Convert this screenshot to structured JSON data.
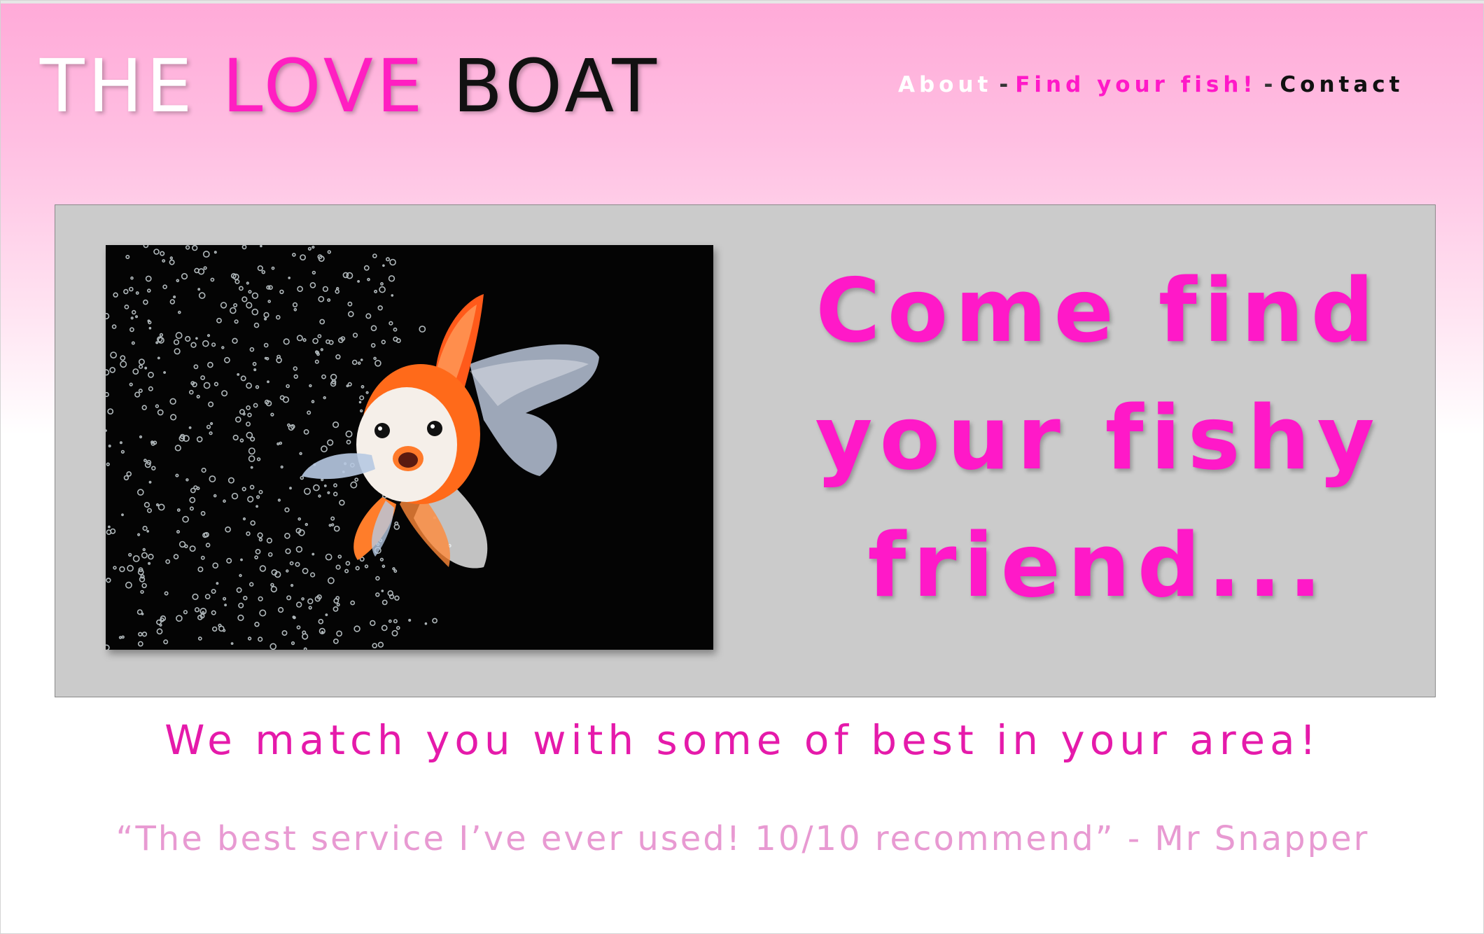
{
  "brand": {
    "word1": "THE",
    "word2": "LOVE",
    "word3": "BOAT"
  },
  "nav": {
    "about": "About",
    "find": "Find your fish!",
    "contact": "Contact",
    "separator": "-"
  },
  "hero": {
    "image_alt": "goldfish with bubbles",
    "headline_line1": "Come find",
    "headline_line2": "your fishy",
    "headline_line3": "friend..."
  },
  "tagline": "We match you with some of best in your area!",
  "testimonial": "“The best service I’ve ever used! 10/10 recommend” - Mr Snapper",
  "colors": {
    "accent_pink": "#ff19c8",
    "header_pink": "#ffaad8",
    "hero_gray": "#cbcbcb",
    "quote_pink": "#e89ad2"
  }
}
